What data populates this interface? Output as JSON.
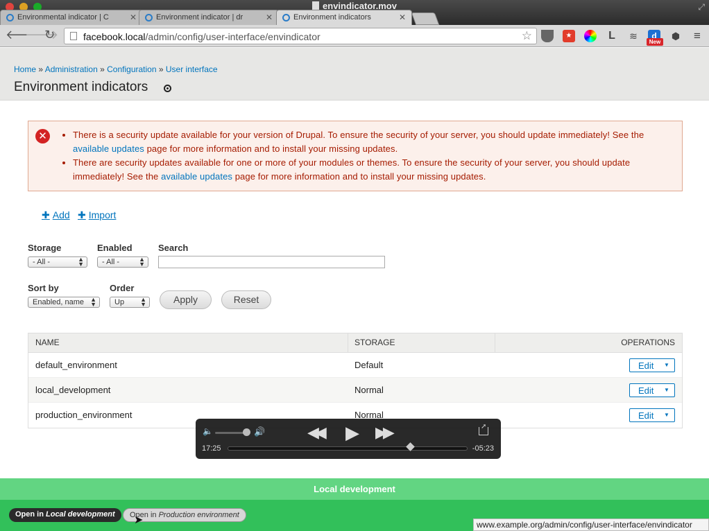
{
  "window": {
    "title": "envindicator.mov",
    "tabs": [
      {
        "label": "Environmental indicator | C"
      },
      {
        "label": "Environment indicator | dr"
      },
      {
        "label": "Environment indicators"
      }
    ]
  },
  "browser": {
    "url_host": "facebook.local",
    "url_path": "/admin/config/user-interface/envindicator",
    "ext_l": "L",
    "ext_new": "New"
  },
  "breadcrumb": {
    "items": [
      "Home",
      "Administration",
      "Configuration",
      "User interface"
    ],
    "separator": "»"
  },
  "page_title": "Environment indicators",
  "messages": {
    "item1": {
      "before": "There is a security update available for your version of Drupal. To ensure the security of your server, you should update immediately! See the ",
      "link": "available updates",
      "after": " page for more information and to install your missing updates."
    },
    "item2": {
      "before": "There are security updates available for one or more of your modules or themes. To ensure the security of your server, you should update immediately! See the ",
      "link": "available updates",
      "after": " page for more information and to install your missing updates."
    }
  },
  "actions": {
    "add": "Add",
    "import": "Import"
  },
  "filters": {
    "storage_label": "Storage",
    "storage_value": "- All -",
    "enabled_label": "Enabled",
    "enabled_value": "- All -",
    "search_label": "Search",
    "search_value": "",
    "sortby_label": "Sort by",
    "sortby_value": "Enabled, name",
    "order_label": "Order",
    "order_value": "Up",
    "apply": "Apply",
    "reset": "Reset"
  },
  "table": {
    "headers": {
      "name": "NAME",
      "storage": "STORAGE",
      "operations": "OPERATIONS"
    },
    "rows": [
      {
        "name": "default_environment",
        "storage": "Default",
        "op": "Edit"
      },
      {
        "name": "local_development",
        "storage": "Normal",
        "op": "Edit"
      },
      {
        "name": "production_environment",
        "storage": "Normal",
        "op": "Edit"
      }
    ]
  },
  "video": {
    "elapsed": "17:25",
    "remaining": "-05:23",
    "progress": 0.76
  },
  "env_bar": {
    "title": "Local development",
    "btn_local_prefix": "Open in ",
    "btn_local_name": "Local development",
    "btn_prod_prefix": "Open in ",
    "btn_prod_name": "Production environment"
  },
  "status_url": "www.example.org/admin/config/user-interface/envindicator"
}
